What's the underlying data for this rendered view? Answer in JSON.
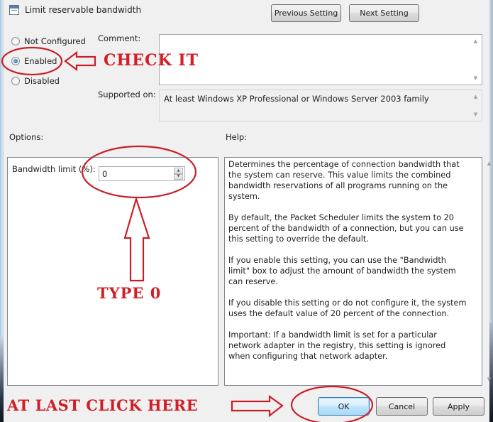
{
  "window": {
    "title": "Limit reservable bandwidth",
    "icon": "policy-setting-icon"
  },
  "nav": {
    "previous_label": "Previous Setting",
    "next_label": "Next Setting"
  },
  "state": {
    "options": [
      {
        "label": "Not Configured",
        "checked": false
      },
      {
        "label": "Enabled",
        "checked": true
      },
      {
        "label": "Disabled",
        "checked": false
      }
    ]
  },
  "comment": {
    "label": "Comment:",
    "value": ""
  },
  "supported": {
    "label": "Supported on:",
    "value": "At least Windows XP Professional or Windows Server 2003 family"
  },
  "options_section": {
    "label": "Options:",
    "bandwidth_label": "Bandwidth limit (%):",
    "bandwidth_value": "0"
  },
  "help_section": {
    "label": "Help:",
    "paragraphs": [
      "Determines the percentage of connection bandwidth that the system can reserve. This value limits the combined bandwidth reservations of all programs running on the system.",
      "By default, the Packet Scheduler limits the system to 20 percent of the bandwidth of a connection, but you can use this setting to override the default.",
      "If you enable this setting, you can use the \"Bandwidth limit\" box to adjust the amount of bandwidth the system can reserve.",
      "If you disable this setting or do not configure it, the system uses the default value of 20 percent of the connection.",
      "Important: If a bandwidth limit is set for a particular network adapter in the registry, this setting is ignored when configuring that network adapter."
    ]
  },
  "footer": {
    "ok_label": "OK",
    "cancel_label": "Cancel",
    "apply_label": "Apply"
  },
  "annotations": {
    "check_it": "CHECK IT",
    "type_0": "TYPE 0",
    "click_here": "AT LAST CLICK HERE",
    "color": "#d01f26"
  },
  "scroll_arrows": {
    "up": "▲",
    "down": "▼"
  }
}
